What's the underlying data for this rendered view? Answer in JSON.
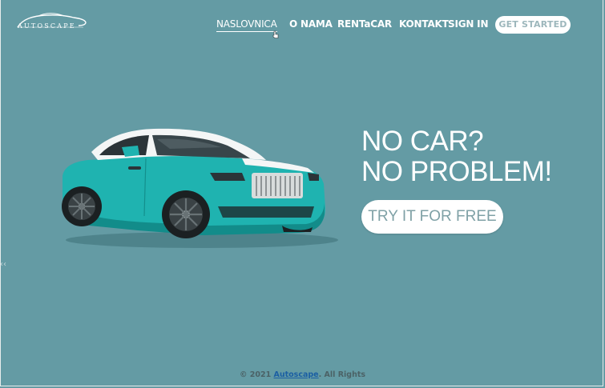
{
  "logo": {
    "text": "AUTOSCAPE",
    "icon": "car-silhouette-logo"
  },
  "nav": {
    "items": [
      {
        "label": "NASLOVNICA",
        "active": true
      },
      {
        "label": "O NAMA",
        "active": false
      },
      {
        "label": "RENTaCAR",
        "active": false
      },
      {
        "label": "KONTAKT",
        "active": false
      },
      {
        "label": "SIGN IN",
        "active": false
      }
    ],
    "cta": "GET STARTED"
  },
  "hero": {
    "line1": "NO CAR?",
    "line2": "NO PROBLEM!",
    "button": "TRY IT FOR FREE"
  },
  "side_handle": "‹‹",
  "footer": {
    "prefix": "© 2021 ",
    "brand": "Autoscape",
    "suffix": ". All Rights"
  },
  "colors": {
    "background": "#649ba4",
    "car_body": "#1fb3b0",
    "button_text": "#7fa1a6",
    "footer_link": "#1b5fa3"
  }
}
